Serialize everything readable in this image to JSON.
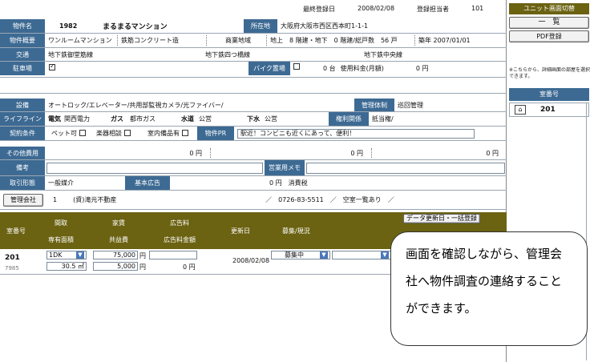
{
  "header": {
    "last_reg_label": "最終登録日",
    "last_reg_date": "2008/02/08",
    "reg_user_label": "登録担当者",
    "reg_user": "101"
  },
  "property": {
    "name_label": "物件名",
    "id": "1982",
    "name": "まるまるマンション",
    "addr_label": "所在地",
    "address": "大阪府大阪市西区西本町1-1-1",
    "summary_label": "物件概要",
    "type": "ワンルームマンション",
    "structure": "鉄筋コンクリート造",
    "zone": "商業地域",
    "floors": "地上　8 階建・地下　0 階建/総戸数　56 戸",
    "built": "築年 2007/01/01",
    "transport_label": "交通",
    "line1": "地下鉄御堂筋線",
    "line2": "地下鉄四つ橋線",
    "line3": "地下鉄中央線",
    "parking_label": "駐車場",
    "bike_label": "バイク置場",
    "bike_count": "0 台",
    "bike_fee_label": "使用料金(月額)",
    "bike_fee": "0 円",
    "equip_label": "設備",
    "equip": "オートロック/エレベーター/共用部監視カメラ/光ファイバー/",
    "mgmt_label": "管理体制",
    "mgmt": "巡回管理",
    "lifeline_label": "ライフライン",
    "elec_label": "電気",
    "elec": "関西電力",
    "gas_label": "ガス",
    "gas": "都市ガス",
    "water_label": "水道",
    "water": "公営",
    "sewer_label": "下水",
    "sewer": "公営",
    "rights_label": "権利関係",
    "rights": "抵当権/",
    "contract_label": "契約条件",
    "pet": "ペット可",
    "music": "楽器相談",
    "indoor": "室内備品有",
    "pr_label": "物件PR",
    "pr": "駅近！コンビニも近くにあって、便利！",
    "other_cost_label": "その他費用",
    "cost1": "0 円",
    "cost2": "0 円",
    "cost3": "0 円",
    "note_label": "備考",
    "biz_memo_label": "営業用メモ",
    "deal_label": "取引形態",
    "deal": "一般媒介",
    "ad_label": "基本広告",
    "ad": "0 円",
    "tax": "消費税",
    "company_btn": "管理会社",
    "company_no": "1",
    "company": "(資)滝元不動産",
    "company_tel": "／　0726-83-5511　／　空室一覧あり　／"
  },
  "units": {
    "update_btn": "データ更新日・一括登録",
    "headers": {
      "room": "室番号",
      "layout": "間取",
      "area": "専有面積",
      "rent": "家賃",
      "common": "共益費",
      "adfee": "広告料",
      "adfee_amt": "広告料金額",
      "updated": "更新日",
      "status": "募集/現況"
    },
    "rows": [
      {
        "room": "201",
        "code": "7985",
        "layout": "1DK",
        "area": "30.5 ㎡",
        "rent": "75,000",
        "common": "5,000",
        "yen": "円",
        "adfee": "0 円",
        "updated": "2008/02/08",
        "status": "募集中"
      }
    ]
  },
  "side": {
    "switch_btn": "ユニット画面切替",
    "list_btn": "一　覧",
    "pdf_btn": "PDF登録",
    "note": "※こちらから、詳細画面の部屋を選択できます。",
    "room_header": "室番号",
    "rooms": [
      "201"
    ]
  },
  "callout": {
    "text": "画面を確認しながら、管理会社へ物件調査の連絡することができます。"
  }
}
